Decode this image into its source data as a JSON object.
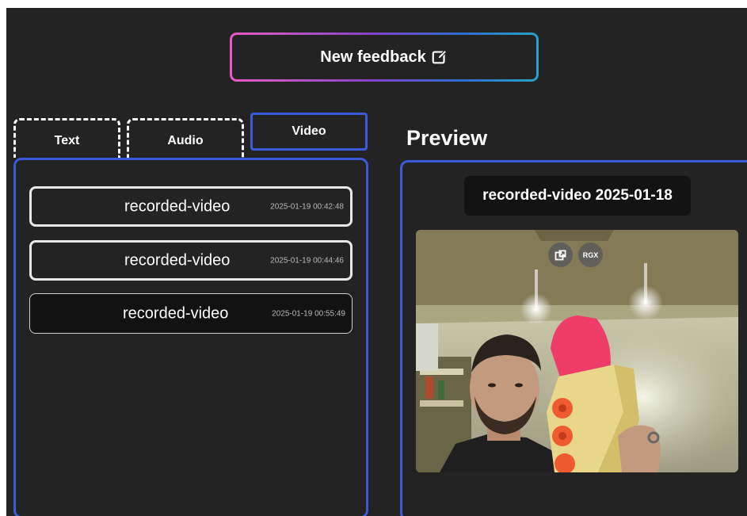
{
  "header": {
    "new_feedback_label": "New feedback"
  },
  "tabs": [
    {
      "label": "Text"
    },
    {
      "label": "Audio"
    },
    {
      "label": "Video",
      "active": true
    }
  ],
  "recordings": [
    {
      "name": "recorded-video",
      "timestamp": "2025-01-19 00:42:48"
    },
    {
      "name": "recorded-video",
      "timestamp": "2025-01-19 00:44:46"
    },
    {
      "name": "recorded-video",
      "timestamp": "2025-01-19 00:55:49",
      "selected": true
    }
  ],
  "preview": {
    "heading": "Preview",
    "title": "recorded-video 2025-01-18",
    "overlay_buttons": [
      {
        "icon": "picture-in-picture-icon"
      },
      {
        "label": "RGX"
      }
    ]
  },
  "colors": {
    "background": "#232323",
    "accent_blue": "#3b5bdb",
    "gradient_pink": "#e65bc8",
    "gradient_cyan": "#2aa0c8"
  }
}
